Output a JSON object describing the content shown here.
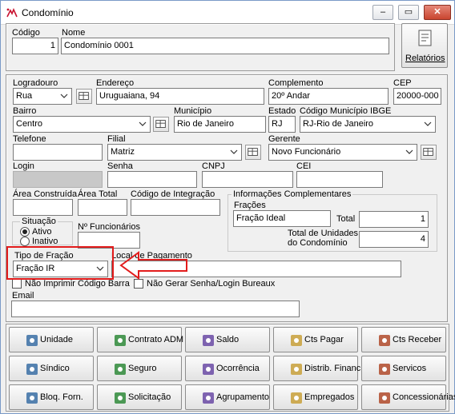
{
  "window": {
    "title": "Condomínio",
    "min_glyph": "–",
    "max_glyph": "▭",
    "close_glyph": "✕"
  },
  "top": {
    "codigo_label": "Código",
    "codigo_value": "1",
    "nome_label": "Nome",
    "nome_value": "Condomínio 0001",
    "relatorios_label": "Relatórios"
  },
  "form": {
    "logradouro_label": "Logradouro",
    "logradouro_value": "Rua",
    "endereco_label": "Endereço",
    "endereco_value": "Uruguaiana, 94",
    "complemento_label": "Complemento",
    "complemento_value": "20º Andar",
    "cep_label": "CEP",
    "cep_value": "20000-000",
    "bairro_label": "Bairro",
    "bairro_value": "Centro",
    "municipio_label": "Município",
    "municipio_value": "Rio de Janeiro",
    "estado_label": "Estado",
    "estado_value": "RJ",
    "codigo_ibge_label": "Código Município IBGE",
    "codigo_ibge_value": "RJ-Rio de Janeiro",
    "telefone_label": "Telefone",
    "telefone_value": "",
    "filial_label": "Filial",
    "filial_value": "Matriz",
    "gerente_label": "Gerente",
    "gerente_value": "Novo Funcionário",
    "login_label": "Login",
    "senha_label": "Senha",
    "cnpj_label": "CNPJ",
    "cei_label": "CEI",
    "area_construida_label": "Área Construída",
    "area_total_label": "Área Total",
    "codigo_integracao_label": "Código de Integração",
    "info_title": "Informações Complementares",
    "fracoes_label": "Frações",
    "fracoes_value": "Fração Ideal",
    "total_label": "Total",
    "total_value": "1",
    "total_unidades_label_1": "Total de Unidades",
    "total_unidades_label_2": "do Condomínio",
    "total_unidades_value": "4",
    "situacao_label": "Situação",
    "ativo_label": "Ativo",
    "inativo_label": "Inativo",
    "num_funcionarios_label": "Nº Funcionários",
    "tipo_fracao_label": "Tipo de Fração",
    "tipo_fracao_value": "Fração IR",
    "local_pagamento_label": "Local de Pagamento",
    "nao_imprimir_label": "Não Imprimir Código Barra",
    "nao_gerar_label": "Não Gerar Senha/Login Bureaux",
    "email_label": "Email",
    "email_value": ""
  },
  "buttons": [
    {
      "label": "Unidade",
      "icon": "building-people-icon"
    },
    {
      "label": "Contrato ADM",
      "icon": "contract-icon"
    },
    {
      "label": "Saldo",
      "icon": "dollar-icon"
    },
    {
      "label": "Cts Pagar",
      "icon": "pay-icon"
    },
    {
      "label": "Cts Receber",
      "icon": "receive-icon"
    },
    {
      "label": "Síndico",
      "icon": "person-icon"
    },
    {
      "label": "Seguro",
      "icon": "safe-icon"
    },
    {
      "label": "Ocorrência",
      "icon": "checklist-icon"
    },
    {
      "label": "Distrib. Financ.",
      "icon": "money-icon"
    },
    {
      "label": "Servicos",
      "icon": "services-icon"
    },
    {
      "label": "Bloq. Forn.",
      "icon": "block-icon"
    },
    {
      "label": "Solicitação",
      "icon": "pen-icon"
    },
    {
      "label": "Agrupamento",
      "icon": "group-icon"
    },
    {
      "label": "Empregados",
      "icon": "employees-icon"
    },
    {
      "label": "Concessionárias",
      "icon": "concession-icon"
    }
  ],
  "annotation_color": "#e21b1b"
}
